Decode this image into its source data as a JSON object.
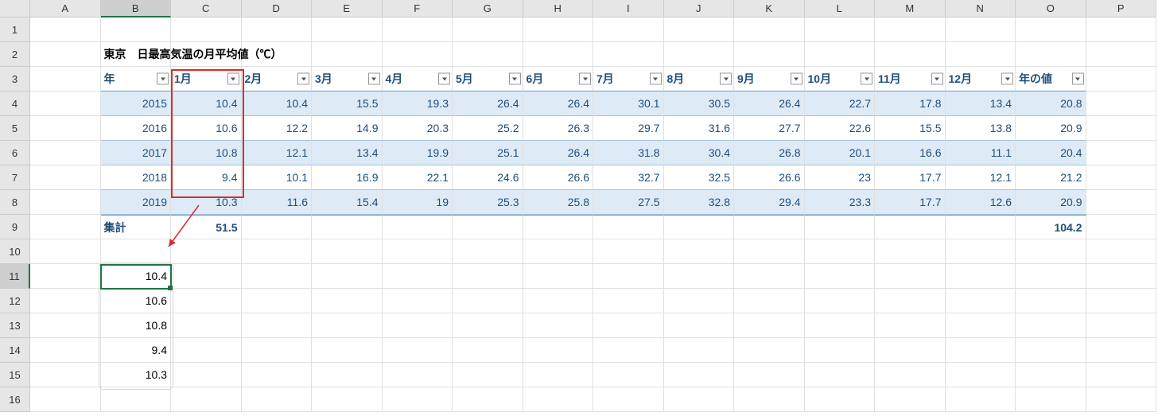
{
  "columns": [
    "A",
    "B",
    "C",
    "D",
    "E",
    "F",
    "G",
    "H",
    "I",
    "J",
    "K",
    "L",
    "M",
    "N",
    "O",
    "P"
  ],
  "colWidths": {
    "default": 88.5,
    "A": 88.5,
    "P": 88.5
  },
  "rowCount": 16,
  "selectedCol": "B",
  "selectedRow": 11,
  "title": "東京　日最高気温の月平均値（℃）",
  "headers": [
    "年",
    "1月",
    "2月",
    "3月",
    "4月",
    "5月",
    "6月",
    "7月",
    "8月",
    "9月",
    "10月",
    "11月",
    "12月",
    "年の値"
  ],
  "data": [
    {
      "year": 2015,
      "vals": [
        10.4,
        10.4,
        15.5,
        19.3,
        26.4,
        26.4,
        30.1,
        30.5,
        26.4,
        22.7,
        17.8,
        13.4,
        20.8
      ]
    },
    {
      "year": 2016,
      "vals": [
        10.6,
        12.2,
        14.9,
        20.3,
        25.2,
        26.3,
        29.7,
        31.6,
        27.7,
        22.6,
        15.5,
        13.8,
        20.9
      ]
    },
    {
      "year": 2017,
      "vals": [
        10.8,
        12.1,
        13.4,
        19.9,
        25.1,
        26.4,
        31.8,
        30.4,
        26.8,
        20.1,
        16.6,
        11.1,
        20.4
      ]
    },
    {
      "year": 2018,
      "vals": [
        9.4,
        10.1,
        16.9,
        22.1,
        24.6,
        26.6,
        32.7,
        32.5,
        26.6,
        23,
        17.7,
        12.1,
        21.2
      ]
    },
    {
      "year": 2019,
      "vals": [
        10.3,
        11.6,
        15.4,
        19,
        25.3,
        25.8,
        27.5,
        32.8,
        29.4,
        23.3,
        17.7,
        12.6,
        20.9
      ]
    }
  ],
  "totalLabel": "集計",
  "totalC": 51.5,
  "totalO": 104.2,
  "copied": [
    10.4,
    10.6,
    10.8,
    9.4,
    10.3
  ]
}
